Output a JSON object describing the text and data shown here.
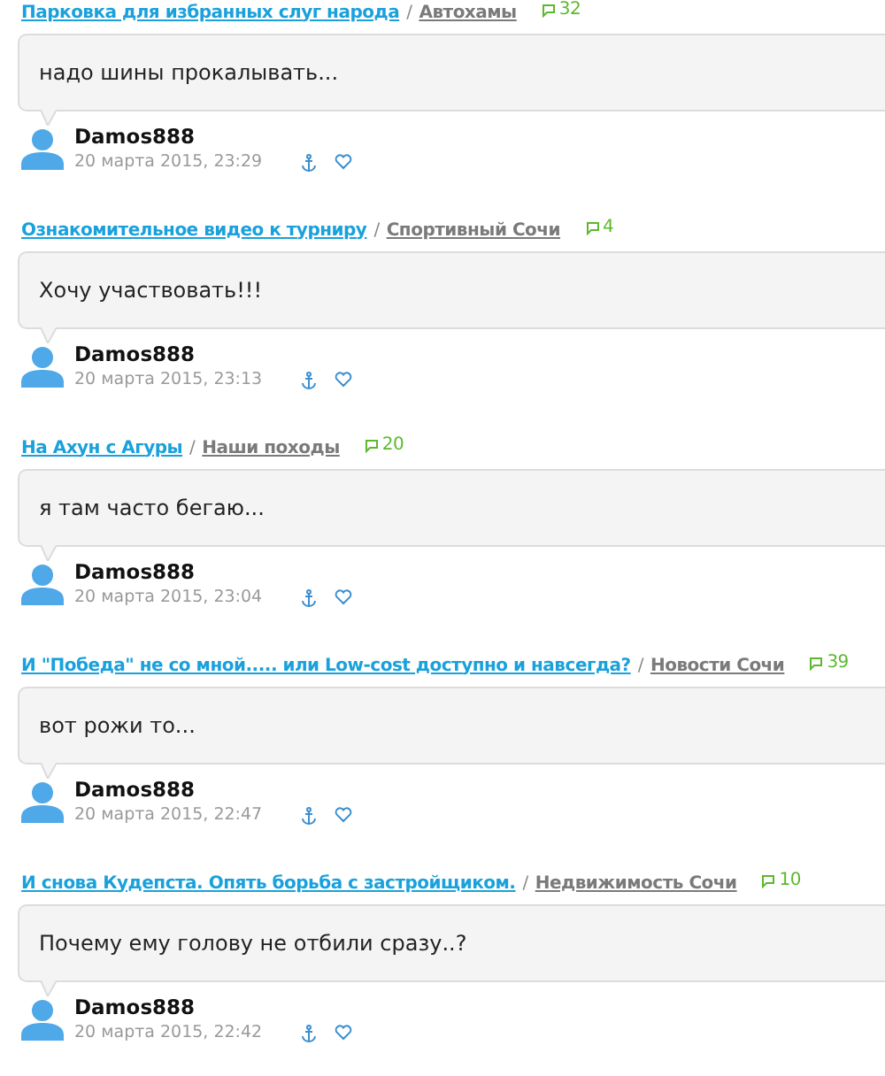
{
  "comments": [
    {
      "title": "Парковка для избранных слуг народа",
      "separator": "/",
      "category": "Автохамы",
      "count": "32",
      "text": "надо шины прокалывать...",
      "author": "Damos888",
      "date": "20 марта 2015, 23:29"
    },
    {
      "title": "Ознакомительное видео к турниру",
      "separator": "/",
      "category": "Спортивный Сочи",
      "count": "4",
      "text": "Хочу участвовать!!!",
      "author": "Damos888",
      "date": "20 марта 2015, 23:13"
    },
    {
      "title": "На Ахун с Агуры",
      "separator": "/",
      "category": "Наши походы",
      "count": "20",
      "text": "я там часто бегаю...",
      "author": "Damos888",
      "date": "20 марта 2015, 23:04"
    },
    {
      "title": "И \"Победа\" не со мной..... или Low-cost доступно и навсегда?",
      "separator": "/",
      "category": "Новости Сочи",
      "count": "39",
      "text": "вот рожи то...",
      "author": "Damos888",
      "date": "20 марта 2015, 22:47"
    },
    {
      "title": "И снова Кудепста. Опять борьба с застройщиком.",
      "separator": "/",
      "category": "Недвижимость Сочи",
      "count": "10",
      "text": "Почему ему голову не отбили сразу..?",
      "author": "Damos888",
      "date": "20 марта 2015, 22:42"
    }
  ]
}
